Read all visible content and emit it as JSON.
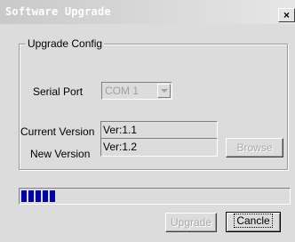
{
  "window": {
    "title": "Software Upgrade",
    "close_glyph": "×"
  },
  "group": {
    "legend": "Upgrade Config"
  },
  "serial_port": {
    "label": "Serial Port",
    "value": "COM 1"
  },
  "current_version": {
    "label": "Current Version",
    "value": "Ver:1.1"
  },
  "new_version": {
    "label": "New Version",
    "value": "Ver:1.2",
    "browse_label": "Browse"
  },
  "progress": {
    "value_fraction": 0.14,
    "color": "#0000a8"
  },
  "buttons": {
    "upgrade_label": "Upgrade",
    "cancel_label": "Cancle"
  },
  "colors": {
    "dialog_bg": "#dcdcdc",
    "disabled_text": "#a8a8a8"
  }
}
